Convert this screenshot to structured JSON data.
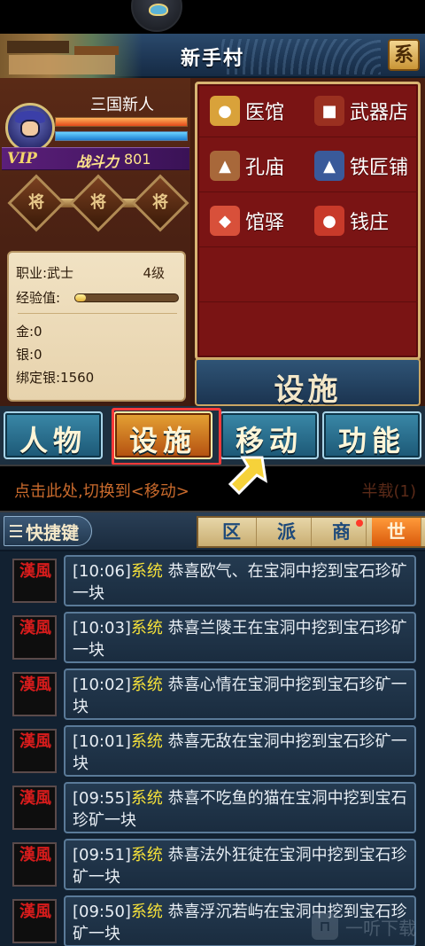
{
  "header": {
    "title": "新手村",
    "system_button": "系"
  },
  "player": {
    "name": "三国新人",
    "hp_fraction": 1.0,
    "mp_fraction": 1.0,
    "vip_label": "VIP",
    "power_label": "战斗力",
    "power_value": "801",
    "general_slots": [
      "将",
      "将",
      "将"
    ]
  },
  "stats": {
    "job": "职业:武士",
    "level": "4级",
    "exp_label": "经验值:",
    "exp_fraction": 0.1,
    "gold": "金:0",
    "silver": "银:0",
    "bound_silver": "绑定银:1560"
  },
  "facilities": {
    "items": [
      {
        "label": "医馆",
        "icon": "medicine-gourd-icon"
      },
      {
        "label": "武器店",
        "icon": "weapon-shop-icon"
      },
      {
        "label": "孔庙",
        "icon": "temple-icon"
      },
      {
        "label": "铁匠铺",
        "icon": "anvil-hammer-icon"
      },
      {
        "label": "馆驿",
        "icon": "post-station-icon"
      },
      {
        "label": "钱庄",
        "icon": "money-bag-icon"
      }
    ],
    "footer": "设施"
  },
  "main_nav": {
    "tabs": [
      {
        "label": "人物"
      },
      {
        "label": "设施",
        "active": true
      },
      {
        "label": "移动"
      },
      {
        "label": "功能"
      }
    ]
  },
  "tip": {
    "text": "点击此处,切换到<移动>",
    "faded": "半载(1)"
  },
  "chat": {
    "shortcut_label": "快捷键",
    "tabs": [
      {
        "label": "区"
      },
      {
        "label": "派"
      },
      {
        "label": "商"
      },
      {
        "label": "世"
      }
    ],
    "sender_badge": "漢風",
    "messages": [
      {
        "time": "[10:06]",
        "channel": "系统",
        "text": " 恭喜欧气、在宝洞中挖到宝石珍矿一块"
      },
      {
        "time": "[10:03]",
        "channel": "系统",
        "text": " 恭喜兰陵王在宝洞中挖到宝石珍矿一块"
      },
      {
        "time": "[10:02]",
        "channel": "系统",
        "text": " 恭喜心情在宝洞中挖到宝石珍矿一块"
      },
      {
        "time": "[10:01]",
        "channel": "系统",
        "text": " 恭喜无敌在宝洞中挖到宝石珍矿一块"
      },
      {
        "time": "[09:55]",
        "channel": "系统",
        "text": " 恭喜不吃鱼的猫在宝洞中挖到宝石珍矿一块"
      },
      {
        "time": "[09:51]",
        "channel": "系统",
        "text": " 恭喜法外狂徒在宝洞中挖到宝石珍矿一块"
      },
      {
        "time": "[09:50]",
        "channel": "系统",
        "text": " 恭喜浮沉若屿在宝洞中挖到宝石珍矿一块"
      }
    ]
  },
  "watermark": "一听下载",
  "colors": {
    "chat_channel": "#f5e13a",
    "active_tab": "#d95a0c",
    "highlight": "#ff3a3a",
    "facility_board": "#7a1414"
  }
}
